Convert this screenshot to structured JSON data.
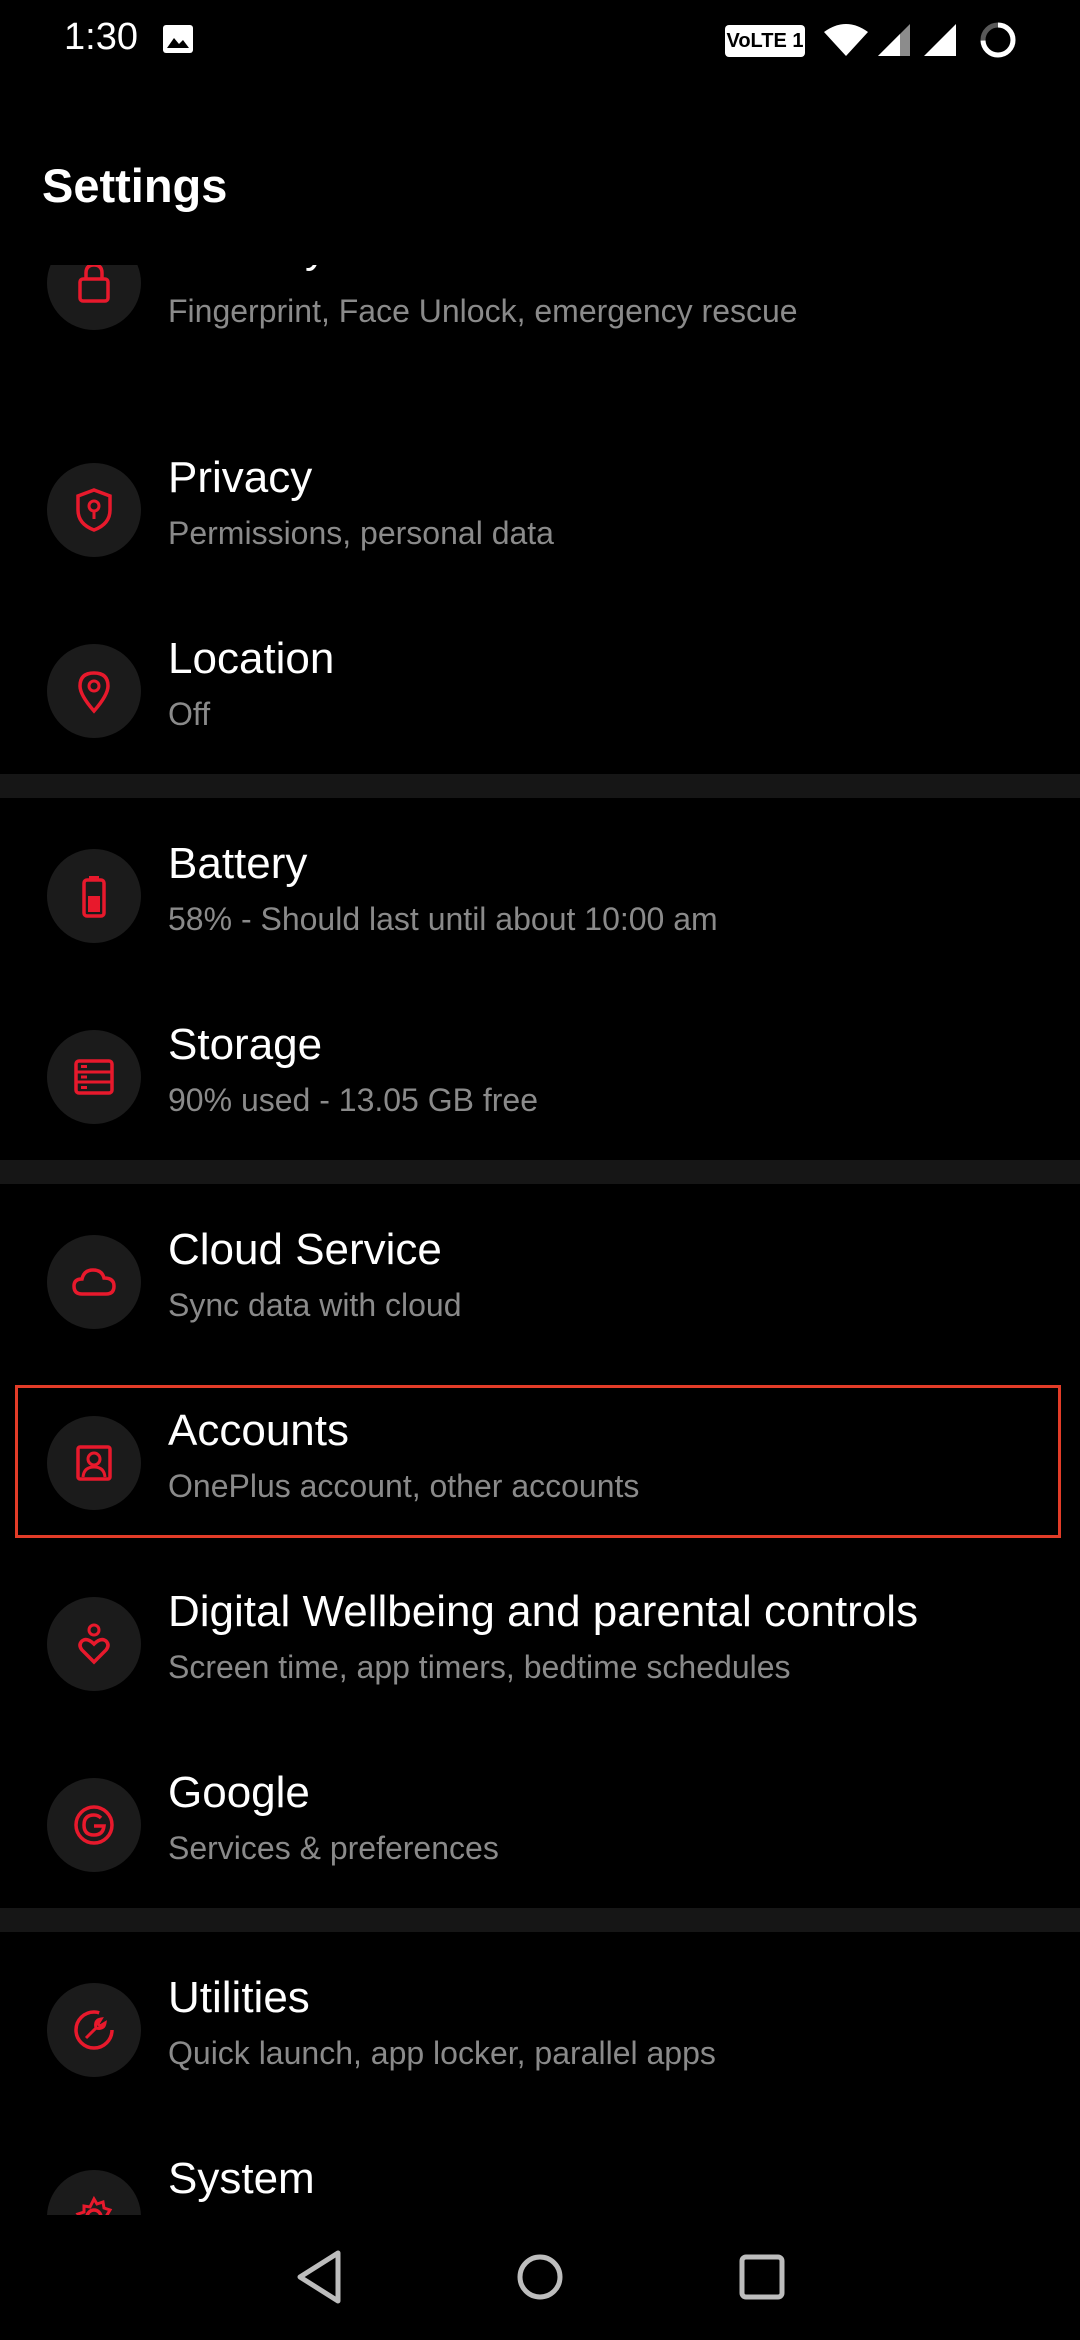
{
  "status_bar": {
    "time": "1:30",
    "network_badge": "VoLTE 1",
    "icons": [
      "image-icon",
      "wifi-icon",
      "signal-icon",
      "signal-icon",
      "battery-ring-icon"
    ]
  },
  "header": {
    "title": "Settings"
  },
  "settings": [
    {
      "title": "Security & lock screen",
      "subtitle": "Fingerprint, Face Unlock, emergency rescue",
      "icon": "lock-icon"
    },
    {
      "title": "Privacy",
      "subtitle": "Permissions, personal data",
      "icon": "shield-icon"
    },
    {
      "title": "Location",
      "subtitle": "Off",
      "icon": "location-pin-icon"
    },
    {
      "title": "Battery",
      "subtitle": "58% - Should last until about 10:00 am",
      "icon": "battery-icon"
    },
    {
      "title": "Storage",
      "subtitle": "90% used - 13.05 GB free",
      "icon": "storage-icon"
    },
    {
      "title": "Cloud Service",
      "subtitle": "Sync data with cloud",
      "icon": "cloud-icon"
    },
    {
      "title": "Accounts",
      "subtitle": "OnePlus account, other accounts",
      "icon": "account-icon"
    },
    {
      "title": "Digital Wellbeing and parental controls",
      "subtitle": "Screen time, app timers, bedtime schedules",
      "icon": "heart-person-icon"
    },
    {
      "title": "Google",
      "subtitle": "Services & preferences",
      "icon": "google-icon"
    },
    {
      "title": "Utilities",
      "subtitle": "Quick launch, app locker, parallel apps",
      "icon": "wrench-icon"
    },
    {
      "title": "System",
      "subtitle": "",
      "icon": "gear-icon"
    }
  ],
  "colors": {
    "accent": "#e8192c",
    "highlight_border": "#e23c28",
    "subtitle": "#8a8a8a",
    "icon_bg": "#1b1b1b",
    "divider": "#161616"
  },
  "nav_bar": {
    "icons": [
      "back-icon",
      "home-icon",
      "recents-icon"
    ]
  }
}
